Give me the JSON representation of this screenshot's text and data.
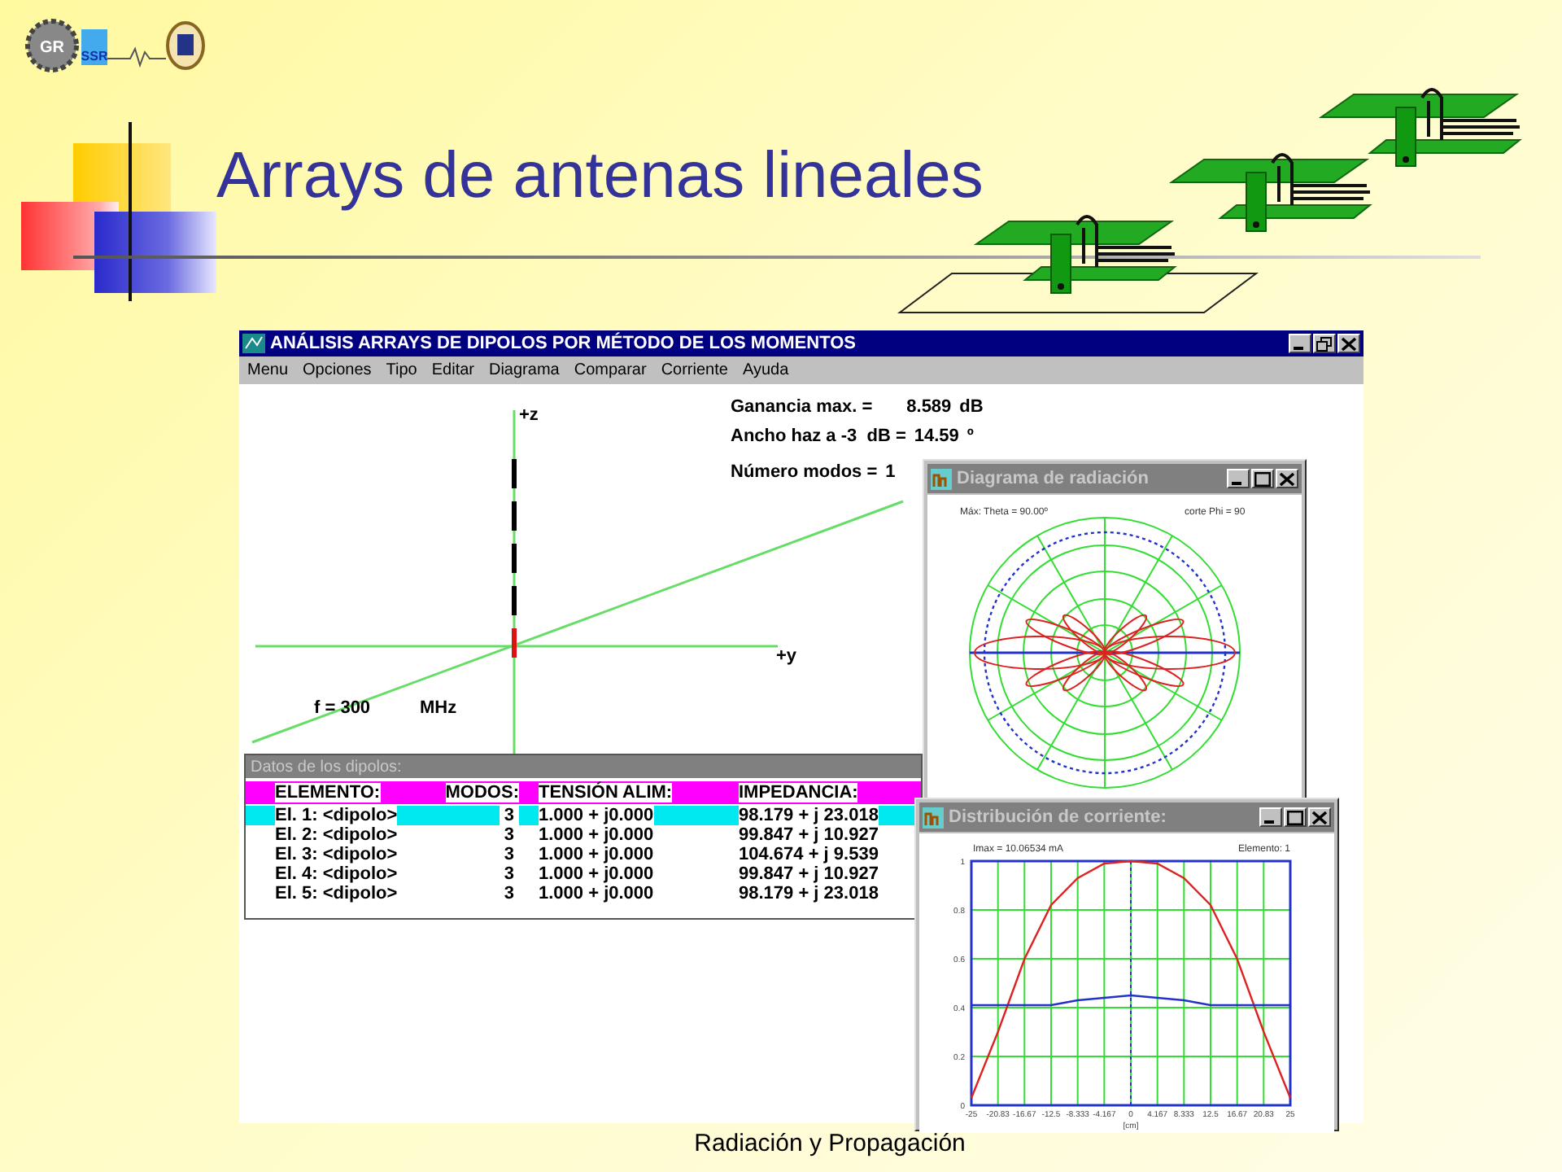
{
  "slide": {
    "title": "Arrays de antenas lineales",
    "footer": "Radiación y Propagación",
    "logo": {
      "gear_text": "GR",
      "badge_text": "SSR"
    }
  },
  "app_window": {
    "title": "ANÁLISIS ARRAYS DE DIPOLOS POR MÉTODO DE LOS MOMENTOS",
    "menu": [
      {
        "label": "Menu"
      },
      {
        "label": "Opciones"
      },
      {
        "label": "Tipo"
      },
      {
        "label": "Editar"
      },
      {
        "label": "Diagrama"
      },
      {
        "label": "Comparar"
      },
      {
        "label": "Corriente"
      },
      {
        "label": "Ayuda"
      }
    ],
    "canvas": {
      "z_axis_label": "+z",
      "y_axis_label": "+y",
      "frequency": {
        "label": "f = 300",
        "unit": "MHz"
      },
      "results": [
        {
          "label": "Ganancia max. =",
          "value": "8.589",
          "unit": "dB"
        },
        {
          "label": "Ancho haz a -3  dB =",
          "value": "14.59",
          "unit": "º"
        },
        {
          "label": "Número modos =",
          "value": "1"
        }
      ]
    },
    "dipole_table": {
      "title": "Datos de los dipolos:",
      "columns": [
        "ELEMENTO:",
        "MODOS:",
        "TENSIÓN ALIM:",
        "IMPEDANCIA:"
      ],
      "rows": [
        {
          "cells": [
            "El. 1: <dipolo>",
            "3",
            "1.000 + j0.000",
            "98.179 + j 23.018"
          ],
          "selected": true
        },
        {
          "cells": [
            "El. 2: <dipolo>",
            "3",
            "1.000 + j0.000",
            "99.847 + j 10.927"
          ],
          "selected": false
        },
        {
          "cells": [
            "El. 3: <dipolo>",
            "3",
            "1.000 + j0.000",
            "104.674 + j 9.539"
          ],
          "selected": false
        },
        {
          "cells": [
            "El. 4: <dipolo>",
            "3",
            "1.000 + j0.000",
            "99.847 + j 10.927"
          ],
          "selected": false
        },
        {
          "cells": [
            "El. 5: <dipolo>",
            "3",
            "1.000 + j0.000",
            "98.179 + j 23.018"
          ],
          "selected": false
        }
      ]
    }
  },
  "radiation_window": {
    "title": "Diagrama de radiación",
    "header_left": "Máx: Theta = 90.00º",
    "header_right": "corte Phi = 90"
  },
  "current_window": {
    "title": "Distribución de corriente:",
    "header_left": "Imax = 10.06534 mA",
    "header_right": "Elemento: 1",
    "chart_data": {
      "type": "line",
      "xlabel": "[cm]",
      "x": [
        -25,
        -20.83,
        -16.67,
        -12.5,
        -8.333,
        -4.167,
        0,
        4.167,
        8.333,
        12.5,
        16.67,
        20.83,
        25
      ],
      "xlim": [
        -25,
        25
      ],
      "ylim": [
        0,
        1
      ],
      "grid": true,
      "ref_lines": [
        {
          "axis": "x",
          "value": 0,
          "color": "#2233cc"
        }
      ],
      "xticks": [
        -25,
        -20.83,
        -16.67,
        -12.5,
        -8.333,
        -4.167,
        0,
        4.167,
        8.333,
        12.5,
        16.67,
        20.83,
        25
      ],
      "yticks": [
        0,
        0.2,
        0.4,
        0.6,
        0.8,
        1
      ],
      "series": [
        {
          "color": "#dd2222",
          "values": [
            0.03,
            0.3,
            0.6,
            0.82,
            0.93,
            0.99,
            1,
            0.99,
            0.93,
            0.82,
            0.6,
            0.3,
            0.03
          ]
        },
        {
          "color": "#2233cc",
          "values": [
            0.41,
            0.41,
            0.41,
            0.41,
            0.43,
            0.44,
            0.45,
            0.44,
            0.43,
            0.41,
            0.41,
            0.41,
            0.41
          ]
        }
      ]
    }
  }
}
